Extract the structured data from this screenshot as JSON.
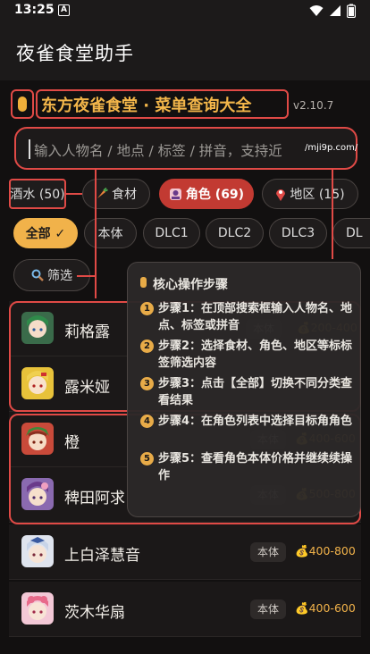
{
  "status": {
    "time": "13:25",
    "a_badge": "A"
  },
  "app": {
    "title": "夜雀食堂助手"
  },
  "header": {
    "title": "东方夜雀食堂 · 菜单查询大全",
    "version": "v2.10.7"
  },
  "search": {
    "placeholder": "输入人物名 / 地点 / 标签 / 拼音，支持近",
    "domain_tag": "/mji9p.com/"
  },
  "categories": [
    {
      "label": "酒水 (50)"
    },
    {
      "icon": "carrot-icon",
      "label": "食材"
    },
    {
      "icon": "character-icon",
      "label": "角色 (69)"
    },
    {
      "icon": "pin-icon",
      "label": "地区 (15)"
    }
  ],
  "sub_filters": [
    "全部 ✓",
    "本体",
    "DLC1",
    "DLC2",
    "DLC3",
    "DL"
  ],
  "filter_button": "筛选",
  "rows": [
    {
      "name": "莉格露",
      "badge": "本体",
      "price": "200-400"
    },
    {
      "name": "露米娅",
      "badge": "",
      "price": "50"
    },
    {
      "name": "橙",
      "badge": "本体",
      "price": "400-600"
    },
    {
      "name": "稗田阿求",
      "badge": "本体",
      "price": "500-800"
    },
    {
      "name": "上白泽慧音",
      "badge": "本体",
      "price": "400-800"
    },
    {
      "name": "茨木华扇",
      "badge": "本体",
      "price": "400-600"
    }
  ],
  "guide": {
    "title": "核心操作步骤",
    "steps": [
      {
        "num": "1",
        "text": "步骤1：在顶部搜索框输入人物名、地点、标签或拼音"
      },
      {
        "num": "2",
        "text": "步骤2：选择食材、角色、地区等标标签筛选内容"
      },
      {
        "num": "3",
        "text": "步骤3：点击【全部】切换不同分类查看结果"
      },
      {
        "num": "4",
        "text": "步骤4：在角色列表中选择目标角角色"
      },
      {
        "num": "5",
        "text": "步骤5：查看角色本体价格并继续续操作"
      }
    ]
  },
  "colors": {
    "accent_red": "#e04a46",
    "gold": "#f1b24a",
    "active_chip": "#c23a32"
  }
}
